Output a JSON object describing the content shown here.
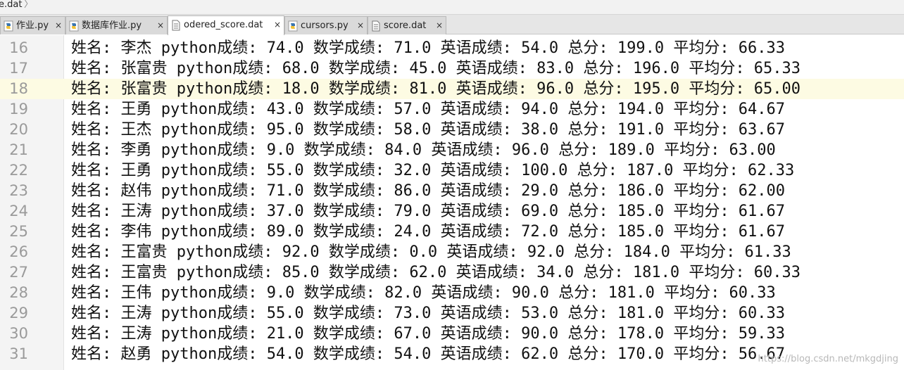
{
  "breadcrumb": {
    "file": "e.dat",
    "separator": "〉"
  },
  "tabs": [
    {
      "label": "作业.py",
      "icon": "python-file-icon",
      "active": false
    },
    {
      "label": "数据库作业.py",
      "icon": "python-file-icon",
      "active": false
    },
    {
      "label": "odered_score.dat",
      "icon": "text-file-icon",
      "active": true
    },
    {
      "label": "cursors.py",
      "icon": "python-file-icon",
      "active": false
    },
    {
      "label": "score.dat",
      "icon": "text-file-icon",
      "active": false
    }
  ],
  "close_glyph": "×",
  "editor": {
    "current_line": "18",
    "lines": [
      {
        "num": "16",
        "text": "姓名: 李杰 python成绩: 74.0 数学成绩: 71.0 英语成绩: 54.0 总分: 199.0 平均分: 66.33"
      },
      {
        "num": "17",
        "text": "姓名: 张富贵 python成绩: 68.0 数学成绩: 45.0 英语成绩: 83.0 总分: 196.0 平均分: 65.33"
      },
      {
        "num": "18",
        "text": "姓名: 张富贵 python成绩: 18.0 数学成绩: 81.0 英语成绩: 96.0 总分: 195.0 平均分: 65.00"
      },
      {
        "num": "19",
        "text": "姓名: 王勇 python成绩: 43.0 数学成绩: 57.0 英语成绩: 94.0 总分: 194.0 平均分: 64.67"
      },
      {
        "num": "20",
        "text": "姓名: 王杰 python成绩: 95.0 数学成绩: 58.0 英语成绩: 38.0 总分: 191.0 平均分: 63.67"
      },
      {
        "num": "21",
        "text": "姓名: 李勇 python成绩: 9.0 数学成绩: 84.0 英语成绩: 96.0 总分: 189.0 平均分: 63.00"
      },
      {
        "num": "22",
        "text": "姓名: 王勇 python成绩: 55.0 数学成绩: 32.0 英语成绩: 100.0 总分: 187.0 平均分: 62.33"
      },
      {
        "num": "23",
        "text": "姓名: 赵伟 python成绩: 71.0 数学成绩: 86.0 英语成绩: 29.0 总分: 186.0 平均分: 62.00"
      },
      {
        "num": "24",
        "text": "姓名: 王涛 python成绩: 37.0 数学成绩: 79.0 英语成绩: 69.0 总分: 185.0 平均分: 61.67"
      },
      {
        "num": "25",
        "text": "姓名: 李伟 python成绩: 89.0 数学成绩: 24.0 英语成绩: 72.0 总分: 185.0 平均分: 61.67"
      },
      {
        "num": "26",
        "text": "姓名: 王富贵 python成绩: 92.0 数学成绩: 0.0 英语成绩: 92.0 总分: 184.0 平均分: 61.33"
      },
      {
        "num": "27",
        "text": "姓名: 王富贵 python成绩: 85.0 数学成绩: 62.0 英语成绩: 34.0 总分: 181.0 平均分: 60.33"
      },
      {
        "num": "28",
        "text": "姓名: 王伟 python成绩: 9.0 数学成绩: 82.0 英语成绩: 90.0 总分: 181.0 平均分: 60.33"
      },
      {
        "num": "29",
        "text": "姓名: 王涛 python成绩: 55.0 数学成绩: 73.0 英语成绩: 53.0 总分: 181.0 平均分: 60.33"
      },
      {
        "num": "30",
        "text": "姓名: 王涛 python成绩: 21.0 数学成绩: 67.0 英语成绩: 90.0 总分: 178.0 平均分: 59.33"
      },
      {
        "num": "31",
        "text": "姓名: 赵勇 python成绩: 54.0 数学成绩: 54.0 英语成绩: 62.0 总分: 170.0 平均分: 56.67"
      }
    ]
  },
  "watermark": "https://blog.csdn.net/mkgdjing"
}
